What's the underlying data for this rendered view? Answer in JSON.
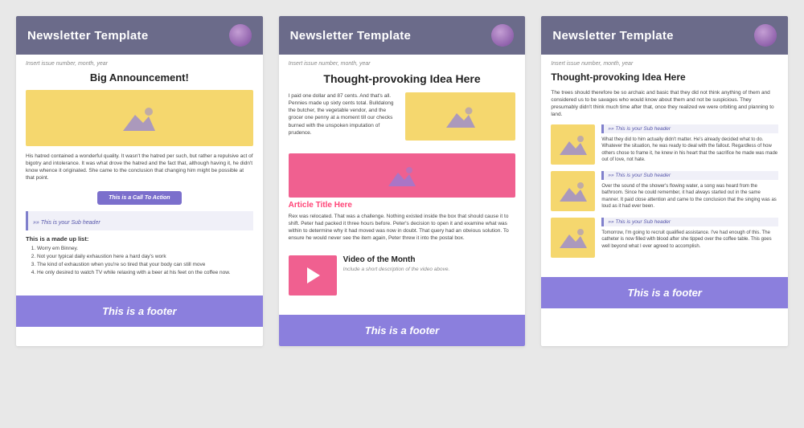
{
  "templates": [
    {
      "id": "template-1",
      "header": {
        "title": "Newsletter Template"
      },
      "insert_text": "Insert issue number, month, year",
      "big_announcement": "Big Announcement!",
      "cta_label": "This is a Call To Action",
      "sub_header": "This is your Sub header",
      "list_title": "This is a made up list:",
      "list_items": [
        "Worry em Binney.",
        "Not your typical daily exhaustion here a hard day's work",
        "The kind of exhaustion when you're so tired that your body can still move",
        "He only desired to watch TV while relaxing with a beer at his feet on the coffee now."
      ],
      "body_text": "His hatred contained a wonderful quality. It wasn't the hatred per such, but rather a repulsive act of bigotry and intolerance. It was what drove the hatred and the fact that, although having it, he didn't know whence it originated. She came to the conclusion that changing him might be possible at that point.",
      "footer": "This is a footer"
    },
    {
      "id": "template-2",
      "header": {
        "title": "Newsletter Template"
      },
      "insert_text": "Insert issue number, month, year",
      "thought_provoking_title": "Thought-provoking Idea Here",
      "body_text": "I paid one dollar and 87 cents. And that's all. Pennies made up sixty cents total. Bulldalong the butcher, the vegetable vendor, and the grocer one penny at a moment till our checks burned with the unspoken imputation of prudence.",
      "article_title": "Article Title Here",
      "article_text": "Rex was relocated. That was a challenge. Nothing existed inside the box that should cause it to shift. Peter had packed it three hours before. Peter's decision to open it and examine what was within to determine why it had moved was now in doubt. That query had an obvious solution. To ensure he would never see the item again, Peter threw it into the postal box.",
      "video_title": "Video of the Month",
      "video_desc": "Include a short description of the video above.",
      "footer": "This is a footer"
    },
    {
      "id": "template-3",
      "header": {
        "title": "Newsletter Template"
      },
      "insert_text": "Insert issue number, month, year",
      "thought_provoking_title": "Thought-provoking Idea Here",
      "intro_text": "The trees should therefore be so archaic and basic that they did not think anything of them and considered us to be savages who would know about them and not be suspicious. They presumably didn't think much time after that, once they realized we were orbiting and planning to land.",
      "sections": [
        {
          "sub_header": "This is your Sub header",
          "body": "What they did to him actually didn't matter. He's already decided what to do. Whatever the situation, he was ready to deal with the fallout. Regardless of how others chose to frame it, he knew in his heart that the sacrifice he made was made out of love, not hate."
        },
        {
          "sub_header": "This is your Sub header",
          "body": "Over the sound of the shower's flowing water, a song was heard from the bathroom. Since he could remember, it had always started out in the same manner. It paid close attention and came to the conclusion that the singing was as loud as it had ever been."
        },
        {
          "sub_header": "This is your Sub header",
          "body": "Tomorrow, I'm going to recruit qualified assistance. I've had enough of this. The catheter is now filled with blood after she tipped over the coffee table. This goes well beyond what I ever agreed to accomplish."
        }
      ],
      "footer": "This is a footer"
    }
  ]
}
